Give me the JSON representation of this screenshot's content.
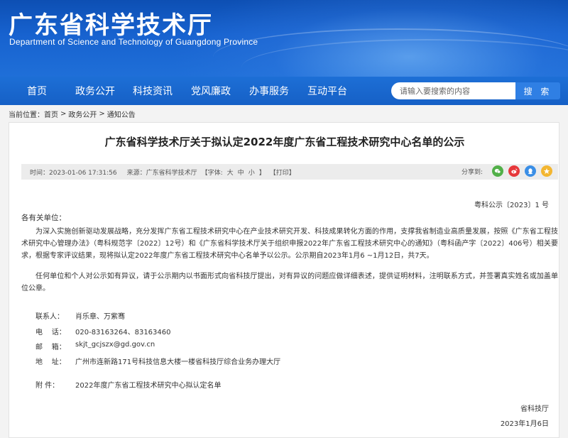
{
  "header": {
    "title": "广东省科学技术厅",
    "subtitle": "Department of Science and Technology of Guangdong Province"
  },
  "nav": {
    "items": [
      "首页",
      "政务公开",
      "科技资讯",
      "党风廉政",
      "办事服务",
      "互动平台"
    ],
    "search_placeholder": "请输入要搜索的内容",
    "search_button": "搜 索"
  },
  "breadcrumb": {
    "label": "当前位置：",
    "items": [
      "首页",
      "政务公开",
      "通知公告"
    ],
    "separator": ">"
  },
  "article": {
    "title": "广东省科学技术厅关于拟认定2022年度广东省工程技术研究中心名单的公示",
    "meta": {
      "time": "时间：2023-01-06 17:31:56",
      "source": "来源：广东省科学技术厅",
      "font_prefix": "【字体:",
      "font_large": "大",
      "font_medium": "中",
      "font_small": "小",
      "font_suffix": "】",
      "print": "【打印】",
      "share_label": "分享到:"
    },
    "share_icons": [
      {
        "name": "wechat-icon",
        "color": "#52b049"
      },
      {
        "name": "weibo-icon",
        "color": "#e6383b"
      },
      {
        "name": "qq-icon",
        "color": "#3a8ee6"
      },
      {
        "name": "qzone-icon",
        "color": "#f3b631"
      }
    ],
    "doc_number": "粤科公示〔2023〕1 号",
    "salutation": "各有关单位：",
    "paragraphs": [
      "为深入实施创新驱动发展战略，充分发挥广东省工程技术研究中心在产业技术研究开发、科技成果转化方面的作用，支撑我省制造业高质量发展，按照《广东省工程技术研究中心管理办法》（粤科规范字〔2022〕12号）和《广东省科学技术厅关于组织申报2022年广东省工程技术研究中心的通知》（粤科函产字〔2022〕406号）相关要求，根据专家评议结果，现将拟认定2022年度广东省工程技术研究中心名单予以公示。公示期自2023年1月6 ~1月12日，共7天。",
      "任何单位和个人对公示如有异议，请于公示期内以书面形式向省科技厅提出，对有异议的问题应做详细表述，提供证明材料，注明联系方式，并签署真实姓名或加盖单位公章。"
    ],
    "contacts": [
      {
        "label": "联系人：",
        "value": "肖乐章、万紫骞"
      },
      {
        "label": "电    话：",
        "value": "020-83163264、83163460"
      },
      {
        "label": "邮    箱：",
        "value": "skjt_gcjszx@gd.gov.cn"
      },
      {
        "label": "地    址：",
        "value": "广州市连新路171号科技信息大楼一楼省科技厅综合业务办理大厅"
      }
    ],
    "attachment": {
      "label": "附    件：",
      "value": "2022年度广东省工程技术研究中心拟认定名单"
    },
    "signature_org": "省科技厅",
    "signature_date": "2023年1月6日"
  }
}
